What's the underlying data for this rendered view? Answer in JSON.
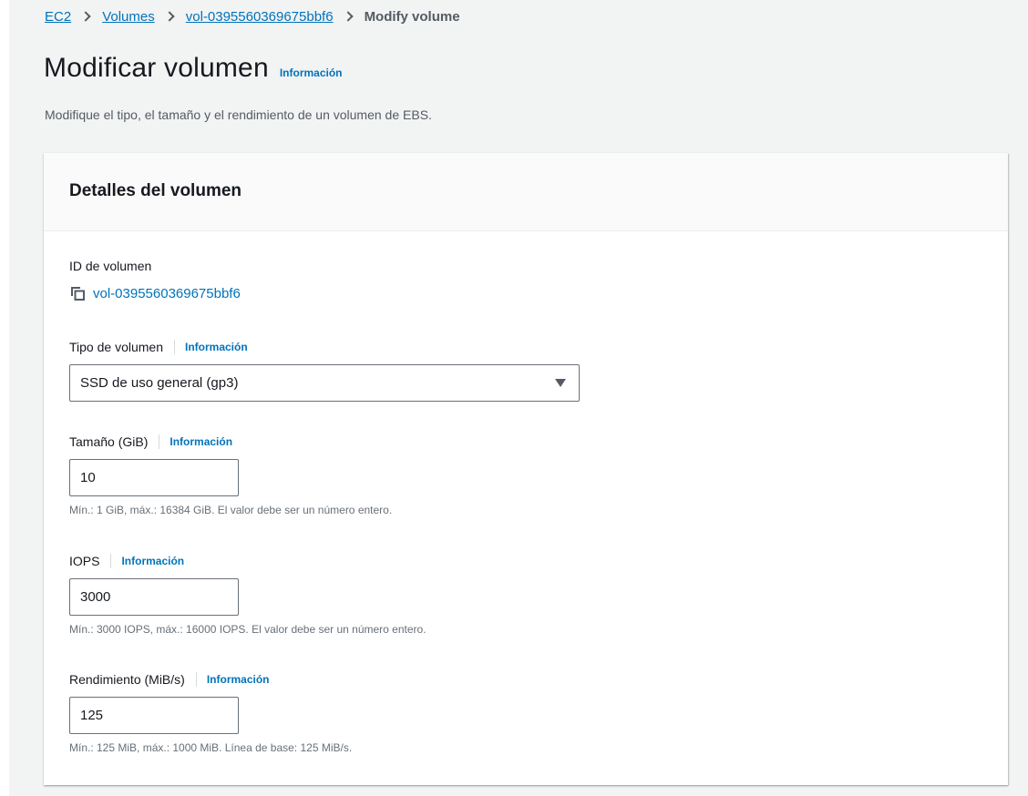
{
  "breadcrumb": {
    "items": [
      "EC2",
      "Volumes",
      "vol-0395560369675bbf6"
    ],
    "current": "Modify volume"
  },
  "page": {
    "title": "Modificar volumen",
    "info": "Información",
    "description": "Modifique el tipo, el tamaño y el rendimiento de un volumen de EBS."
  },
  "panel": {
    "title": "Detalles del volumen",
    "volume_id": {
      "label": "ID de volumen",
      "value": "vol-0395560369675bbf6"
    },
    "volume_type": {
      "label": "Tipo de volumen",
      "info": "Información",
      "selected": "SSD de uso general (gp3)"
    },
    "size": {
      "label": "Tamaño (GiB)",
      "info": "Información",
      "value": "10",
      "hint": "Mín.: 1 GiB, máx.: 16384 GiB. El valor debe ser un número entero."
    },
    "iops": {
      "label": "IOPS",
      "info": "Información",
      "value": "3000",
      "hint": "Mín.: 3000 IOPS, máx.: 16000 IOPS. El valor debe ser un número entero."
    },
    "throughput": {
      "label": "Rendimiento (MiB/s)",
      "info": "Información",
      "value": "125",
      "hint": "Mín.: 125 MiB, máx.: 1000 MiB. Línea de base: 125 MiB/s."
    }
  },
  "icons": {
    "copy": "copy-icon",
    "chevron": "chevron-right-icon",
    "caret": "caret-down-icon"
  },
  "colors": {
    "link": "#0073bb",
    "background": "#f2f3f3",
    "text": "#16191f",
    "secondary_text": "#545b64"
  }
}
